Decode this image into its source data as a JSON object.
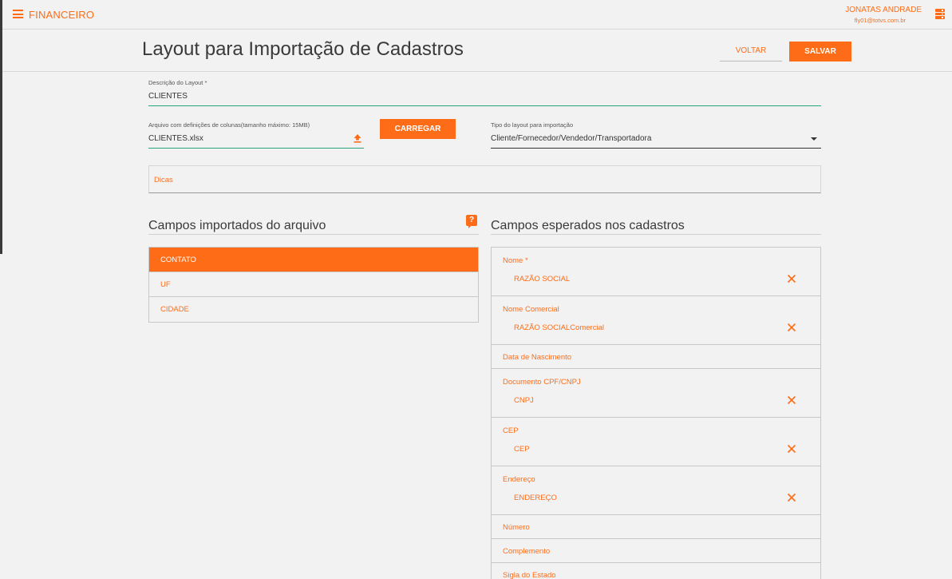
{
  "app": {
    "title": "FINANCEIRO",
    "user_name": "JONATAS ANDRADE",
    "user_email": "fly01@totvs.com.br",
    "icons": {
      "menu": "menu-icon",
      "server": "server-icon"
    },
    "accent_color": "#ff6c17",
    "field_underline_color": "#2aa47e"
  },
  "header": {
    "title": "Layout para Importação de Cadastros",
    "voltar_label": "VOLTAR",
    "salvar_label": "SALVAR"
  },
  "form": {
    "descricao_label": "Descrição do Layout *",
    "descricao_value": "CLIENTES",
    "arquivo_label": "Arquivo com definições de colunas(tamanho máximo: 15MB)",
    "arquivo_value": "CLIENTES.xlsx",
    "carregar_label": "CARREGAR",
    "tipo_label": "Tipo do layout para importação",
    "tipo_value": "Cliente/Fornecedor/Vendedor/Transportadora",
    "dicas_label": "Dicas"
  },
  "imported": {
    "title": "Campos importados do arquivo",
    "help_glyph": "?",
    "items": [
      {
        "label": "CONTATO",
        "selected": true
      },
      {
        "label": "UF",
        "selected": false
      },
      {
        "label": "CIDADE",
        "selected": false
      }
    ]
  },
  "expected": {
    "title": "Campos esperados nos cadastros",
    "items": [
      {
        "label": "Nome *",
        "value": "RAZÃO SOCIAL"
      },
      {
        "label": "Nome Comercial",
        "value": "RAZÃO SOCIALComercial"
      },
      {
        "label": "Data de Nascimento",
        "value": null
      },
      {
        "label": "Documento CPF/CNPJ",
        "value": "CNPJ"
      },
      {
        "label": "CEP",
        "value": "CEP"
      },
      {
        "label": "Endereço",
        "value": "ENDEREÇO"
      },
      {
        "label": "Número",
        "value": null
      },
      {
        "label": "Complemento",
        "value": null
      },
      {
        "label": "Sigla do Estado",
        "value": null
      }
    ]
  }
}
